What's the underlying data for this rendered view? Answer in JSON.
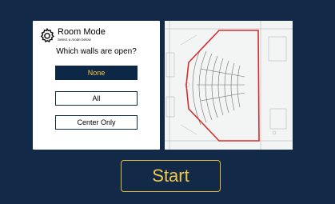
{
  "room_mode": {
    "title": "Room Mode",
    "subtitle": "Select a mode below",
    "question": "Which walls are open?",
    "options": [
      {
        "label": "None",
        "selected": true
      },
      {
        "label": "All",
        "selected": false
      },
      {
        "label": "Center Only",
        "selected": false
      }
    ]
  },
  "floor_plan": {
    "icon": "floor-plan-drawing",
    "highlight_color": "#d32f2f"
  },
  "start_label": "Start",
  "colors": {
    "background": "#122a47",
    "accent": "#f2c94c",
    "selected_option": "#0d2746"
  }
}
